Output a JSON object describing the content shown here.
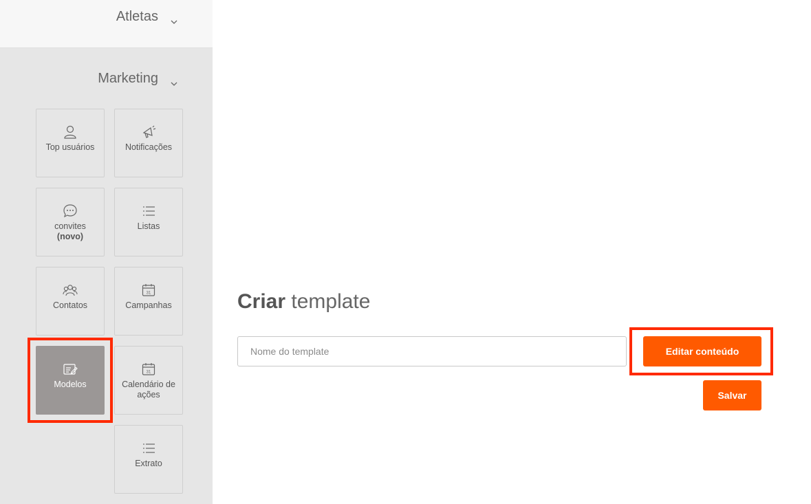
{
  "sidebar": {
    "sections": [
      {
        "label": "Atletas"
      },
      {
        "label": "Marketing"
      }
    ],
    "tiles": [
      {
        "label": "Top usuários",
        "icon": "user-icon"
      },
      {
        "label": "Notificações",
        "icon": "megaphone-icon"
      },
      {
        "label": "convites",
        "label_bold": "(novo)",
        "icon": "chat-bubble-icon"
      },
      {
        "label": "Listas",
        "icon": "list-icon"
      },
      {
        "label": "Contatos",
        "icon": "contacts-icon"
      },
      {
        "label": "Campanhas",
        "icon": "calendar-icon"
      },
      {
        "label": "Modelos",
        "icon": "template-edit-icon",
        "active": true
      },
      {
        "label": "Calendário de ações",
        "icon": "calendar-icon"
      },
      {
        "label": "Extrato",
        "icon": "list-icon"
      }
    ]
  },
  "main": {
    "title_bold": "Criar",
    "title_rest": "template",
    "name_input": {
      "placeholder": "Nome do template",
      "value": ""
    },
    "edit_button": "Editar conteúdo",
    "save_button": "Salvar"
  },
  "colors": {
    "accent": "#ff5a00",
    "highlight": "#ff2a00",
    "active_tile": "#9b9796",
    "sidebar_bg": "#e6e6e6"
  }
}
